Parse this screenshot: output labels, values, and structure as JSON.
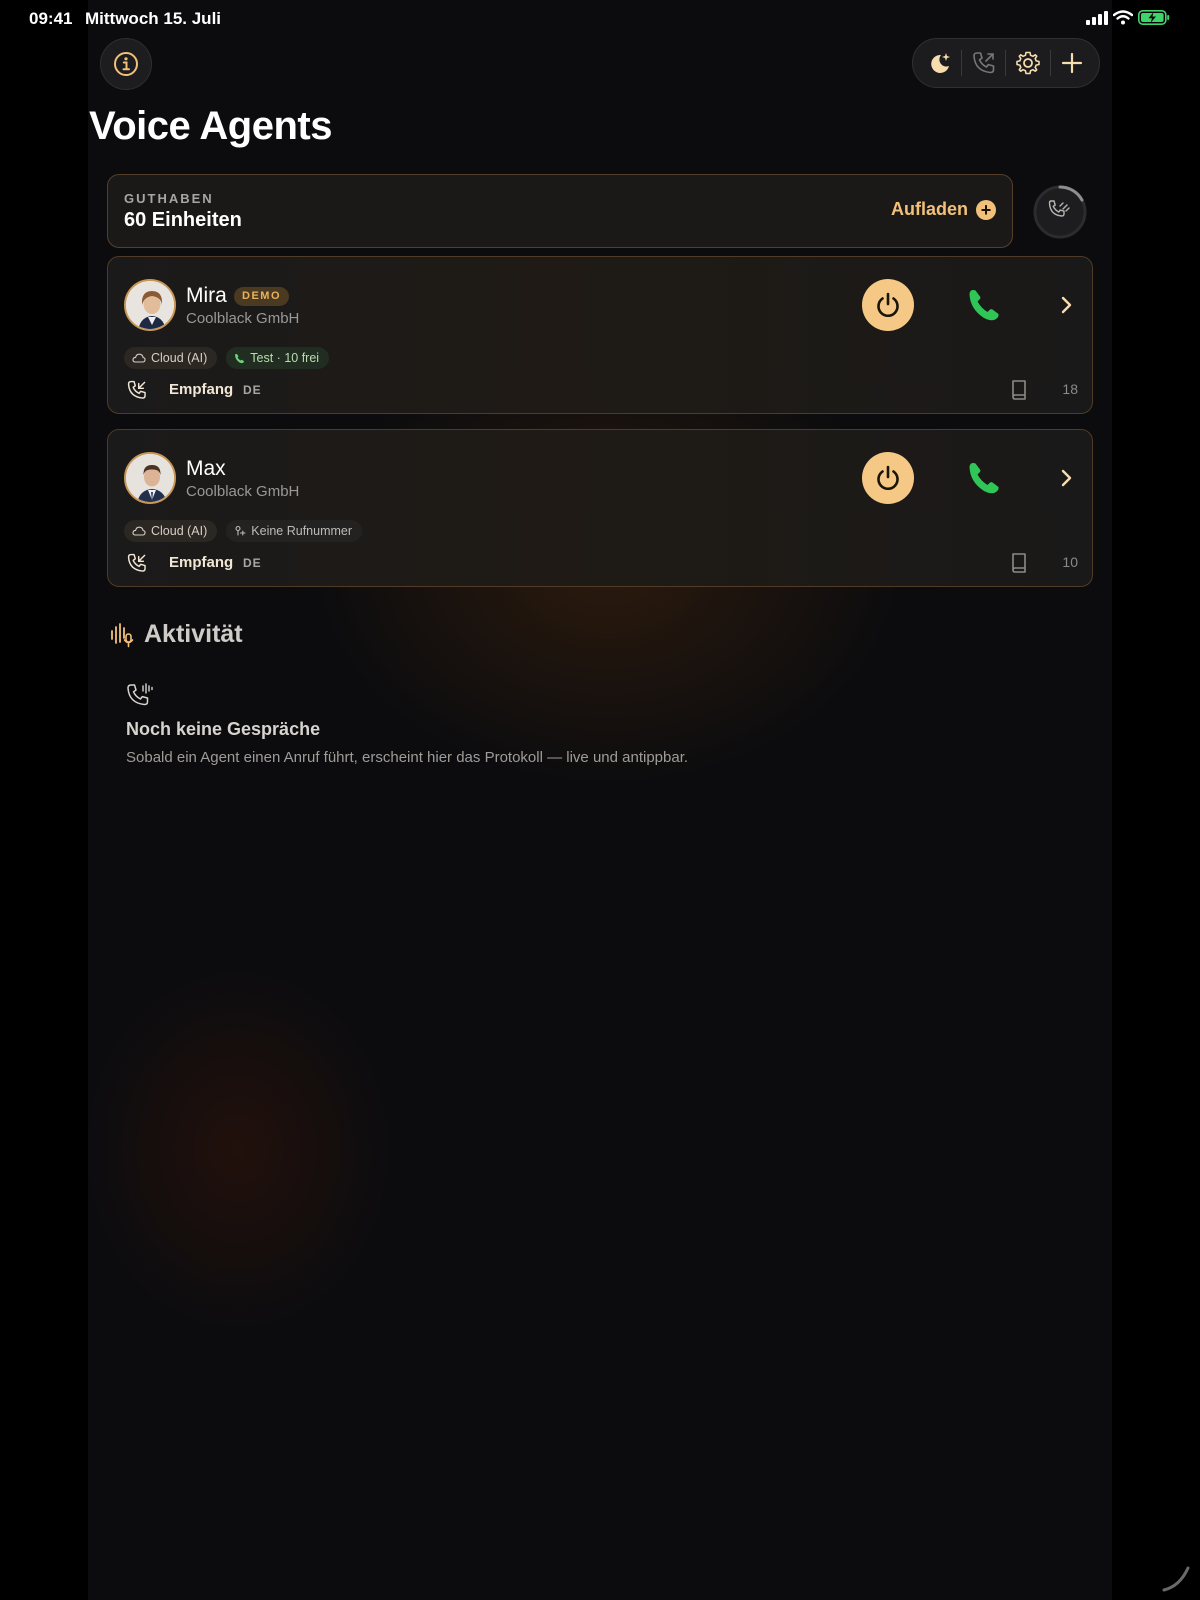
{
  "status_bar": {
    "time": "09:41",
    "date": "Mittwoch 15. Juli"
  },
  "header": {
    "title": "Voice Agents"
  },
  "toolbar": {
    "icons": [
      "moon-sparkle-icon",
      "outgoing-call-icon",
      "gear-icon",
      "plus-icon"
    ]
  },
  "balance": {
    "label": "GUTHABEN",
    "value": "60 Einheiten",
    "topup_label": "Aufladen"
  },
  "agents": [
    {
      "name": "Mira",
      "badge": "DEMO",
      "company": "Coolblack GmbH",
      "chips": [
        "Cloud (AI)",
        "Test · 10 frei"
      ],
      "route": "Empfang",
      "language": "DE",
      "knowledge_count": "18"
    },
    {
      "name": "Max",
      "badge": "",
      "company": "Coolblack GmbH",
      "chips": [
        "Cloud (AI)",
        "Keine Rufnummer"
      ],
      "route": "Empfang",
      "language": "DE",
      "knowledge_count": "10"
    }
  ],
  "activity": {
    "title": "Aktivität",
    "empty_title": "Noch keine Gespräche",
    "empty_desc": "Sobald ein Agent einen Anruf führt, erscheint hier das Protokoll — live und antippbar."
  },
  "colors": {
    "accent": "#f2c079",
    "call_green": "#30c557",
    "background": "#0c0c0e"
  }
}
